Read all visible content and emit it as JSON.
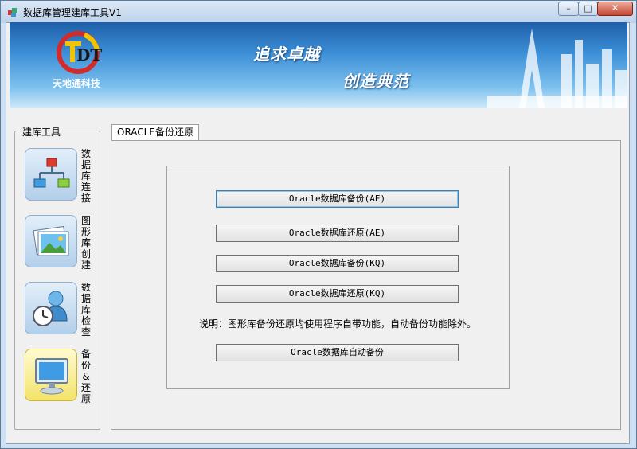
{
  "window": {
    "title": "数据库管理建库工具V1",
    "controls": {
      "minimize": "–",
      "maximize": "□",
      "close": "✕"
    }
  },
  "banner": {
    "logo_text": "TDT",
    "company": "天地通科技",
    "slogan_line1": "追求卓越",
    "slogan_line2": "创造典范"
  },
  "sidebar": {
    "group_title": "建库工具",
    "items": [
      {
        "label": "数据库连接",
        "icon": "network-diagram-icon"
      },
      {
        "label": "图形库创建",
        "icon": "picture-icon"
      },
      {
        "label": "数据库检查",
        "icon": "user-clock-icon"
      },
      {
        "label": "备份&还原",
        "icon": "monitor-icon"
      }
    ]
  },
  "tab": {
    "label": "ORACLE备份还原"
  },
  "actions": [
    {
      "label": "Oracle数据库备份(AE)"
    },
    {
      "label": "Oracle数据库还原(AE)"
    },
    {
      "label": "Oracle数据库备份(KQ)"
    },
    {
      "label": "Oracle数据库还原(KQ)"
    }
  ],
  "note": "说明：图形库备份还原均使用程序自带功能，自动备份功能除外。",
  "auto_backup": {
    "label": "Oracle数据库自动备份"
  },
  "colors": {
    "banner_blue": "#3b8ed6",
    "logo_red": "#d32b2b",
    "logo_yellow": "#f2c400"
  }
}
